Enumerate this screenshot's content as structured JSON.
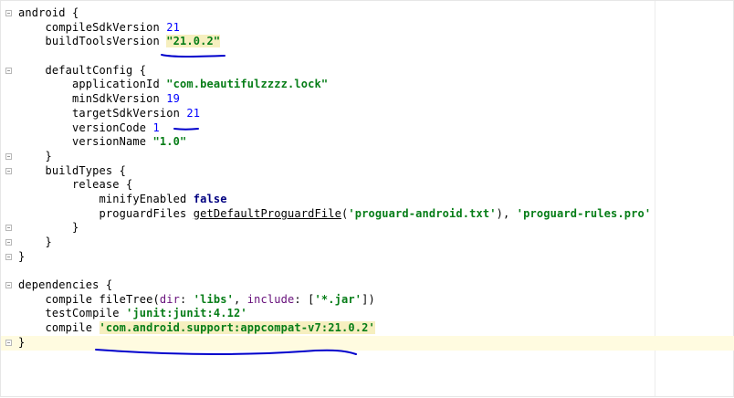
{
  "code": {
    "l1": {
      "text": "android {"
    },
    "l2": {
      "key": "    compileSdkVersion ",
      "value": "21"
    },
    "l3": {
      "key": "    buildToolsVersion ",
      "value": "\"21.0.2\""
    },
    "l5": {
      "text": "    defaultConfig {"
    },
    "l6": {
      "key": "        applicationId ",
      "value": "\"com.beautifulzzzz.lock\""
    },
    "l7": {
      "key": "        minSdkVersion ",
      "value": "19"
    },
    "l8": {
      "key": "        targetSdkVersion ",
      "value": "21"
    },
    "l9": {
      "key": "        versionCode ",
      "value": "1"
    },
    "l10": {
      "key": "        versionName ",
      "value": "\"1.0\""
    },
    "l11": {
      "text": "    }"
    },
    "l12": {
      "text": "    buildTypes {"
    },
    "l13": {
      "text": "        release {"
    },
    "l14": {
      "key": "            minifyEnabled ",
      "value": "false"
    },
    "l15": {
      "key": "            proguardFiles ",
      "call": "getDefaultProguardFile",
      "open": "(",
      "arg1": "'proguard-android.txt'",
      "close": "), ",
      "arg2": "'proguard-rules.pro'"
    },
    "l16": {
      "text": "        }"
    },
    "l17": {
      "text": "    }"
    },
    "l18": {
      "text": "}"
    },
    "l20": {
      "text": "dependencies {"
    },
    "l21": {
      "pre": "    compile fileTree(",
      "named1": "dir",
      "sep1": ": ",
      "arg1": "'libs'",
      "sep2": ", ",
      "named2": "include",
      "sep3": ": [",
      "arg2": "'*.jar'",
      "post": "])"
    },
    "l22": {
      "key": "    testCompile ",
      "value": "'junit:junit:4.12'"
    },
    "l23": {
      "key": "    compile ",
      "value": "'com.android.support:appcompat-v7:21.0.2'"
    },
    "l24": {
      "text": "}"
    }
  },
  "colors": {
    "string": "#067d17",
    "number": "#0000ff",
    "keyword": "#000080",
    "named_arg": "#660e7a",
    "annotation_pen": "#0000cc",
    "highlight": "#f6efbf",
    "current_line": "#fffbe0"
  }
}
